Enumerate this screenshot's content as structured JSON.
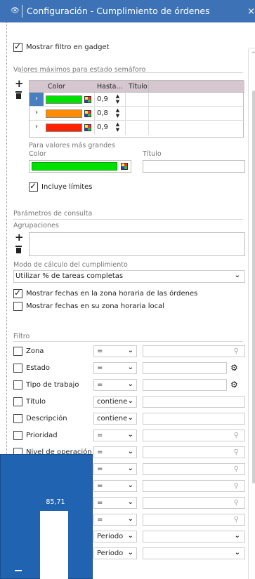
{
  "window": {
    "title": "Configuración -  Cumplimiento de órdenes",
    "close_label": "×"
  },
  "options": {
    "show_filter_label": "Mostrar filtro en gadget",
    "show_filter_checked": true
  },
  "semaphore": {
    "section_title": "Valores máximos para estado semáforo",
    "add_label": "+",
    "columns": [
      "Color",
      "Hasta...",
      "Título"
    ],
    "rows": [
      {
        "color": "#00e000",
        "value": "0,9",
        "title": "",
        "selected": true
      },
      {
        "color": "#ff8c00",
        "value": "0,8",
        "title": "",
        "selected": false
      },
      {
        "color": "#ff2000",
        "value": "0,9",
        "title": "",
        "selected": false
      }
    ],
    "larger_title": "Para valores más grandes",
    "larger_color_label": "Color",
    "larger_title_label": "Título",
    "larger_color": "#00e000",
    "larger_title_value": "",
    "include_limits_label": "Incluye límites",
    "include_limits_checked": true
  },
  "query": {
    "section_title": "Parámetros de consulta",
    "groupings_label": "Agrupaciones",
    "add_label": "+",
    "calc_mode_label": "Modo de cálculo del cumplimiento",
    "calc_mode_value": "Utilizar % de tareas completas",
    "order_tz_label": "Mostrar fechas en la zona horaria de las órdenes",
    "order_tz_checked": true,
    "local_tz_label": "Mostrar fechas en su zona horaria local",
    "local_tz_checked": false
  },
  "filter": {
    "section_title": "Filtro",
    "rows": [
      {
        "label": "Zona",
        "op": "=",
        "trail": "search"
      },
      {
        "label": "Estado",
        "op": "=",
        "trail": "gear"
      },
      {
        "label": "Tipo de trabajo",
        "op": "=",
        "trail": "gear"
      },
      {
        "label": "Título",
        "op": "contiene",
        "trail": ""
      },
      {
        "label": "Descripción",
        "op": "contiene",
        "trail": ""
      },
      {
        "label": "Prioridad",
        "op": "=",
        "trail": "search"
      },
      {
        "label": "Nivel de operación",
        "op": "=",
        "trail": "search"
      },
      {
        "label": "",
        "op": "=",
        "trail": "search"
      },
      {
        "label": "",
        "op": "=",
        "trail": "search"
      },
      {
        "label": "",
        "op": "=",
        "trail": "search"
      },
      {
        "label": "",
        "op": "=",
        "trail": "search"
      },
      {
        "label": "",
        "op": "Periodo",
        "trail": "dropdown"
      },
      {
        "label": "",
        "op": "Periodo",
        "trail": "dropdown"
      }
    ]
  },
  "gadget": {
    "value_label": "85,71"
  },
  "colors": {
    "titlebar": "#3d73b6",
    "gadget_bg": "#1f63b1",
    "selected_row": "#4a7fbf",
    "table_header": "#d6c6d0"
  }
}
